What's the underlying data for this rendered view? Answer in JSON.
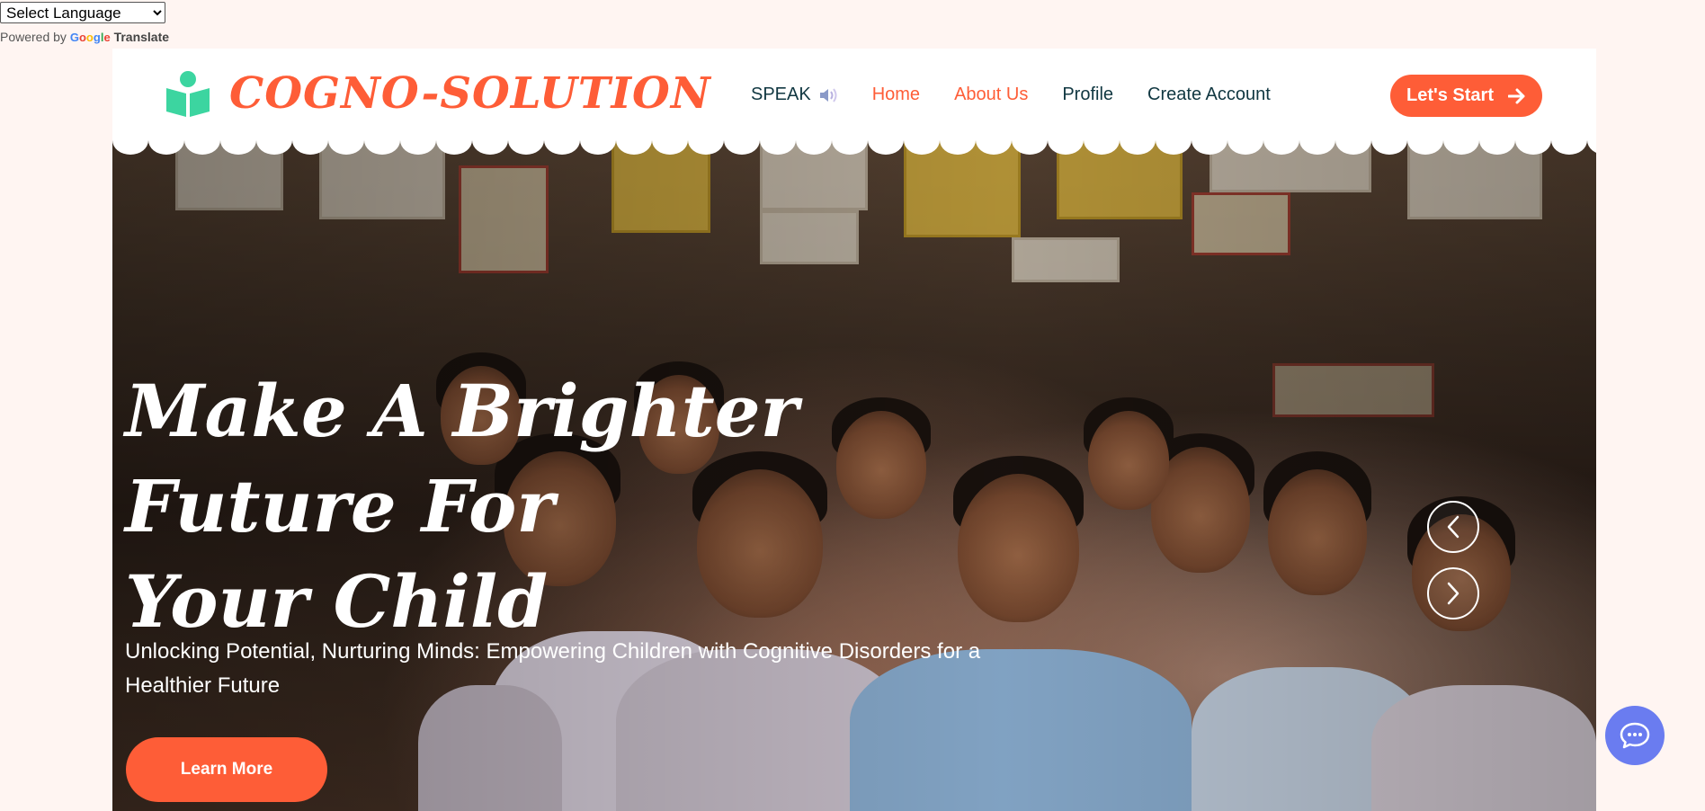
{
  "translate": {
    "select_value": "Select Language",
    "powered_by": "Powered by",
    "google": "Google",
    "translate": "Translate"
  },
  "header": {
    "logo_text": "COGNO-SOLUTION",
    "nav": {
      "speak": "SPEAK",
      "home": "Home",
      "about": "About Us",
      "profile": "Profile",
      "create_account": "Create Account"
    },
    "cta": "Let's Start"
  },
  "hero": {
    "title_line1": "Make A Brighter Future For",
    "title_line2": "Your Child",
    "subtitle": "Unlocking Potential, Nurturing Minds: Empowering Children with Cognitive Disorders for a Healthier Future",
    "button": "Learn More"
  },
  "icons": {
    "logo": "book-reader-icon",
    "speak": "speaker-icon",
    "cta": "arrow-right-icon",
    "prev": "chevron-left-icon",
    "next": "chevron-right-icon",
    "chat": "chat-bubble-icon"
  },
  "colors": {
    "accent": "#fe5d37",
    "logo_icon": "#3cd5a0",
    "nav_text": "#103741",
    "page_bg": "#fff5f2",
    "chat": "#6a7cf0"
  }
}
